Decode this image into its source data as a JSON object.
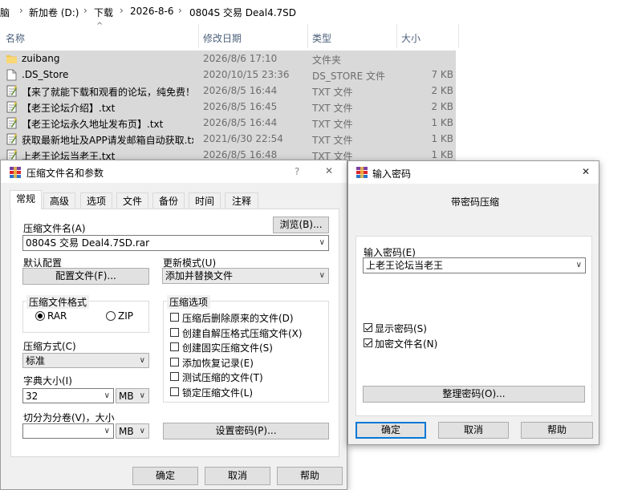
{
  "explorer": {
    "breadcrumb": [
      "脑",
      "新加卷 (D:)",
      "下载",
      "2026-8-6",
      "0804S 交易 Deal4.7SD"
    ],
    "columns": {
      "name": "名称",
      "date": "修改日期",
      "type": "类型",
      "size": "大小"
    },
    "files": [
      {
        "name": "zuibang",
        "date": "2026/8/6 17:10",
        "type": "文件夹",
        "size": "",
        "icon": "folder-icon"
      },
      {
        "name": ".DS_Store",
        "date": "2020/10/15 23:36",
        "type": "DS_STORE 文件",
        "size": "7 KB",
        "icon": "file-icon"
      },
      {
        "name": "【来了就能下载和观看的论坛，纯免费！...",
        "date": "2026/8/5 16:44",
        "type": "TXT 文件",
        "size": "2 KB",
        "icon": "text-file-icon"
      },
      {
        "name": "【老王论坛介绍】.txt",
        "date": "2026/8/5 16:45",
        "type": "TXT 文件",
        "size": "2 KB",
        "icon": "text-file-icon"
      },
      {
        "name": "【老王论坛永久地址发布页】.txt",
        "date": "2026/8/5 16:44",
        "type": "TXT 文件",
        "size": "1 KB",
        "icon": "text-file-icon"
      },
      {
        "name": "获取最新地址及APP请发邮箱自动获取.txt",
        "date": "2021/6/30 22:54",
        "type": "TXT 文件",
        "size": "1 KB",
        "icon": "text-file-icon"
      },
      {
        "name": "上老王论坛当老王.txt",
        "date": "2026/8/5 16:48",
        "type": "TXT 文件",
        "size": "1 KB",
        "icon": "text-file-icon"
      }
    ]
  },
  "archive_dialog": {
    "title": "压缩文件名和参数",
    "help": "?",
    "close": "✕",
    "tabs": [
      "常规",
      "高级",
      "选项",
      "文件",
      "备份",
      "时间",
      "注释"
    ],
    "archive_name_label": "压缩文件名(A)",
    "browse_button": "浏览(B)...",
    "archive_name_value": "0804S 交易 Deal4.7SD.rar",
    "default_profile_label": "默认配置",
    "profile_button": "配置文件(F)...",
    "update_mode_label": "更新模式(U)",
    "update_mode_value": "添加并替换文件",
    "format_group": "压缩文件格式",
    "format_rar": "RAR",
    "format_zip": "ZIP",
    "options_group": "压缩选项",
    "options": [
      {
        "label": "压缩后删除原来的文件(D)",
        "checked": false
      },
      {
        "label": "创建自解压格式压缩文件(X)",
        "checked": false
      },
      {
        "label": "创建固实压缩文件(S)",
        "checked": false
      },
      {
        "label": "添加恢复记录(E)",
        "checked": false
      },
      {
        "label": "测试压缩的文件(T)",
        "checked": false
      },
      {
        "label": "锁定压缩文件(L)",
        "checked": false
      }
    ],
    "method_label": "压缩方式(C)",
    "method_value": "标准",
    "dict_label": "字典大小(I)",
    "dict_value": "32",
    "dict_unit": "MB",
    "split_label": "切分为分卷(V)，大小",
    "split_value": "",
    "split_unit": "MB",
    "set_password_button": "设置密码(P)...",
    "ok": "确定",
    "cancel": "取消",
    "help_button": "帮助"
  },
  "password_dialog": {
    "title": "输入密码",
    "close": "✕",
    "heading": "带密码压缩",
    "password_label": "输入密码(E)",
    "password_value": "上老王论坛当老王",
    "show_password": "显示密码(S)",
    "encrypt_names": "加密文件名(N)",
    "organize_button": "整理密码(O)...",
    "ok": "确定",
    "cancel": "取消",
    "help": "帮助"
  }
}
